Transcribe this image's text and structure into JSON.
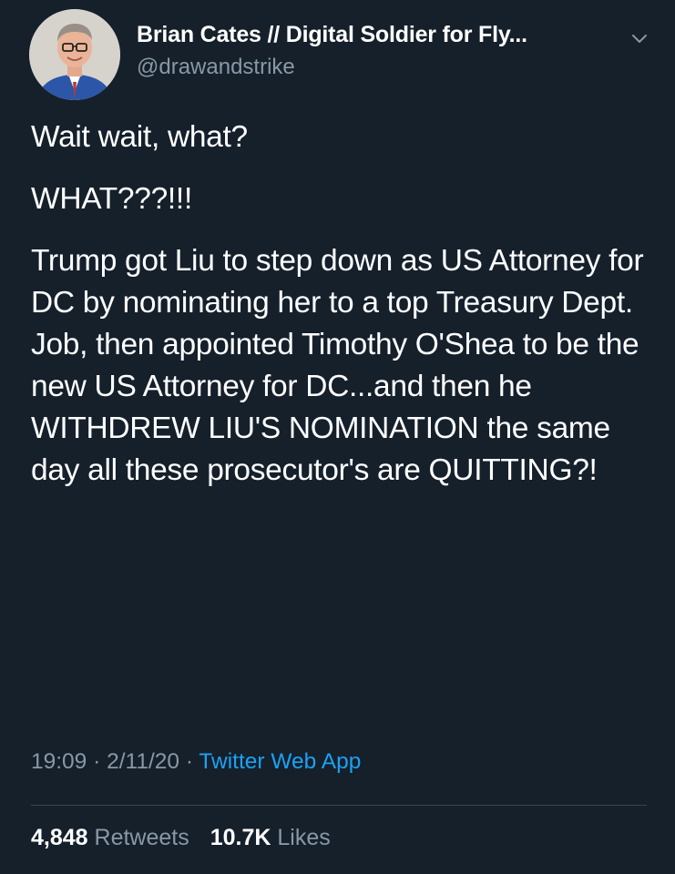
{
  "colors": {
    "background": "#15202b",
    "primary_text": "#ffffff",
    "secondary_text": "#8899a6",
    "link": "#1da1f2",
    "divider": "#38444d"
  },
  "author": {
    "display_name": "Brian Cates // Digital Soldier for Fly...",
    "handle": "@drawandstrike",
    "avatar_icon": "user-avatar",
    "menu_icon": "chevron-down-icon"
  },
  "tweet": {
    "paragraphs": [
      "Wait wait, what?",
      "WHAT???!!!",
      "Trump got Liu to step down as US Attorney for DC by nominating her to a top Treasury Dept. Job, then appointed Timothy O'Shea to be the new US Attorney for DC...and then he WITHDREW LIU'S NOMINATION the same day all these prosecutor's are QUITTING?!"
    ],
    "time": "19:09",
    "separator": "·",
    "date": "2/11/20",
    "source": "Twitter Web App"
  },
  "stats": {
    "retweets_count": "4,848",
    "retweets_label": "Retweets",
    "likes_count": "10.7K",
    "likes_label": "Likes"
  }
}
